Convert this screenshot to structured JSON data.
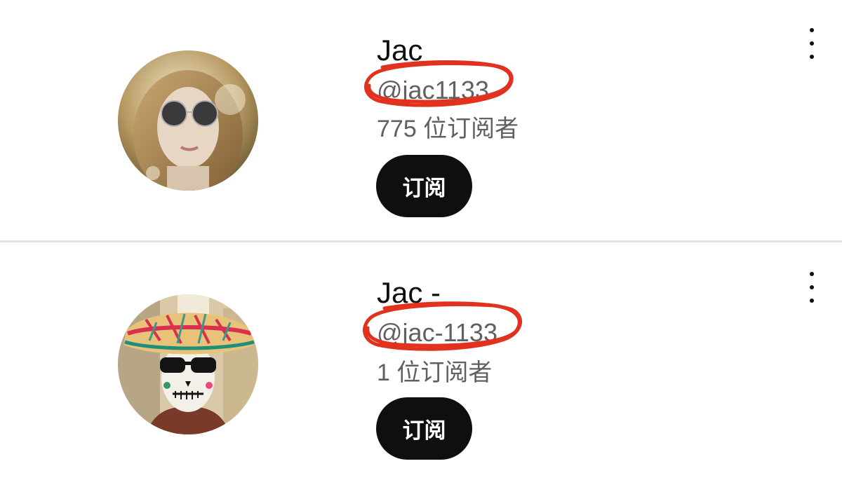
{
  "channels": [
    {
      "name": "Jac",
      "handle": "@jac1133",
      "subscribers": "775 位订阅者",
      "subscribe_label": "订阅",
      "more_icon": "vertical-ellipsis-icon",
      "avatar": "woman-with-round-sunglasses"
    },
    {
      "name": "Jac -",
      "handle": "@jac-1133",
      "subscribers": "1 位订阅者",
      "subscribe_label": "订阅",
      "more_icon": "vertical-ellipsis-icon",
      "avatar": "person-with-sombrero-and-skull-face-paint"
    }
  ],
  "colors": {
    "button_bg": "#0f0f0f",
    "secondary_text": "#606060",
    "annotation_red": "#e0321e",
    "divider": "#e5e5e5"
  }
}
